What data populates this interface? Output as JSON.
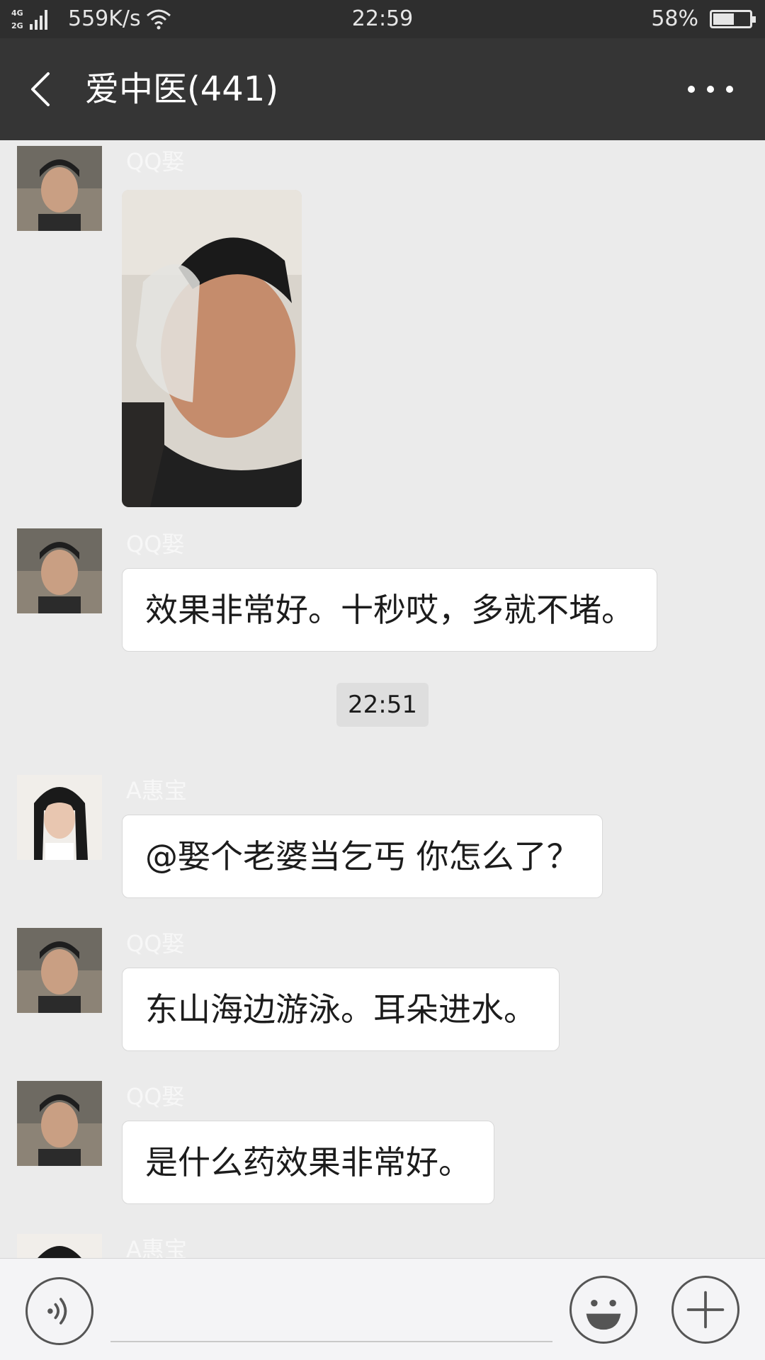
{
  "status_bar": {
    "network": "4G 2G",
    "speed": "559K/s",
    "time": "22:59",
    "battery_text": "58%",
    "battery_level": 0.58
  },
  "header": {
    "title": "爱中医(441)",
    "back_icon": "chevron-left-icon",
    "more_icon": "more-dots-icon"
  },
  "messages": [
    {
      "sender": "QQ娶",
      "type": "image"
    },
    {
      "sender": "QQ娶",
      "type": "text",
      "text": "效果非常好。十秒哎，多就不堵。"
    },
    {
      "type": "time",
      "text": "22:51"
    },
    {
      "sender": "A惠宝",
      "type": "text",
      "text": "@娶个老婆当乞丐  你怎么了？"
    },
    {
      "sender": "QQ娶",
      "type": "text",
      "text": "东山海边游泳。耳朵进水。"
    },
    {
      "sender": "QQ娶",
      "type": "text",
      "text": "是什么药效果非常好。"
    },
    {
      "sender": "A惠宝",
      "type": "text",
      "text": ""
    }
  ],
  "input_bar": {
    "voice_icon": "voice-icon",
    "input_placeholder": "",
    "emoji_icon": "emoji-icon",
    "plus_icon": "plus-icon"
  },
  "colors": {
    "status_bar_bg": "#2e2e2e",
    "title_bar_bg": "#353535",
    "chat_bg": "#ebebeb",
    "bubble_bg": "#ffffff"
  }
}
